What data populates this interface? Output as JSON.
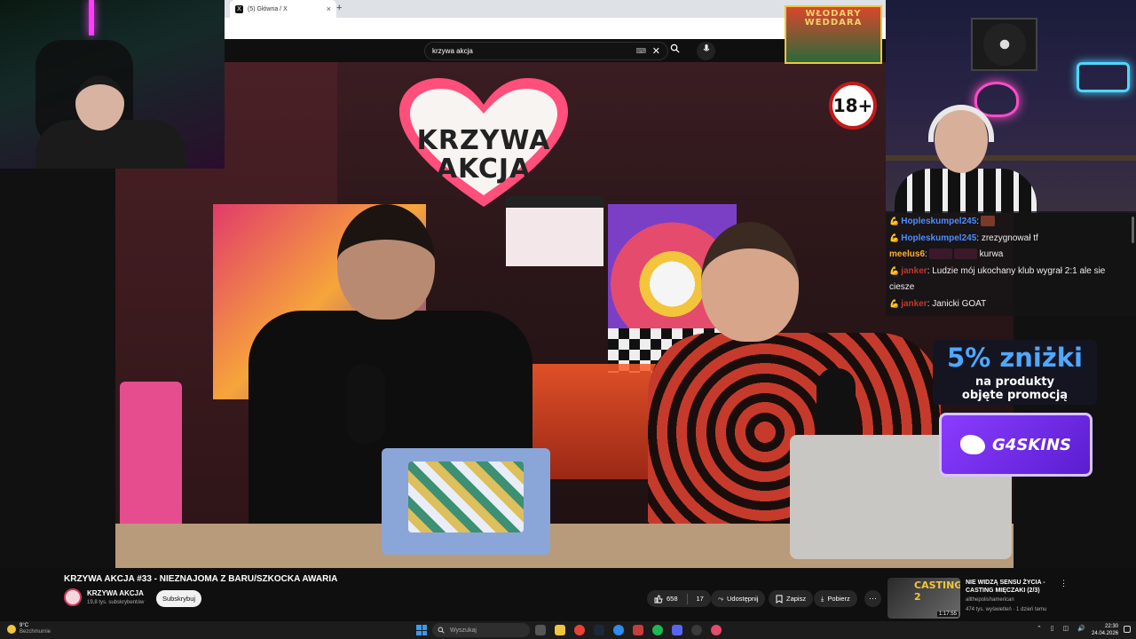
{
  "browser": {
    "tab_title": "(5) Główna / X",
    "tab_close": "×",
    "new_tab": "+"
  },
  "youtube": {
    "search_value": "krzywa akcja",
    "search_kbd": "⌨",
    "search_clear": "✕",
    "video": {
      "title": "KRZYWA AKCJA #33 - NIEZNAJOMA Z BARU/SZKOCKA AWARIA",
      "channel": "KRZYWA AKCJA",
      "subscribers": "19,8 tys. subskrybentów",
      "subscribe_label": "Subskrybuj",
      "likes": "658",
      "comments": "17",
      "share_label": "Udostępnij",
      "save_label": "Zapisz",
      "download_label": "Pobierz",
      "more": "···"
    },
    "recommended": {
      "title": "NIE WIDZĄ SENSU ŻYCIA - CASTING MIĘCZAKI (2/3)",
      "channel": "allthepolishamerican",
      "meta": "474 tys. wyświetleń · 1 dzień temu",
      "duration": "1:17:55",
      "thumb_text": "CASTING 2"
    }
  },
  "scene": {
    "heart_line1": "KRZYWA",
    "heart_line2": "AKCJA",
    "age_badge": "18+",
    "poster_line1": "WŁODARY",
    "poster_line2": "WEDDARA"
  },
  "chat": [
    {
      "user": "Hopleskumpel245",
      "sep": ":",
      "message": "",
      "color": "#4c8cff",
      "emotes": 1
    },
    {
      "user": "Hopleskumpel245",
      "sep": ":",
      "message": "zrezygnował tf",
      "color": "#4c8cff",
      "emotes": 0
    },
    {
      "user": "meelus6",
      "sep": ":",
      "message": "kurwa",
      "color": "#ffb02e",
      "emotes": 2
    },
    {
      "user": "janker",
      "sep": ":",
      "message": "Ludzie mój ukochany klub wygrał 2:1 ale sie ciesze",
      "color": "#c0392b",
      "emotes": 0
    },
    {
      "user": "janker",
      "sep": ":",
      "message": "Janicki GOAT",
      "color": "#c0392b",
      "emotes": 0
    }
  ],
  "promo": {
    "headline": "5% zniżki",
    "line1": "na produkty",
    "line2": "objęte promocją",
    "brand": "G4SKINS"
  },
  "taskbar": {
    "temp": "9°C",
    "weather": "Bezchmurnie",
    "search_placeholder": "Wyszukaj",
    "time": "22:30",
    "date": "24.04.2026"
  }
}
